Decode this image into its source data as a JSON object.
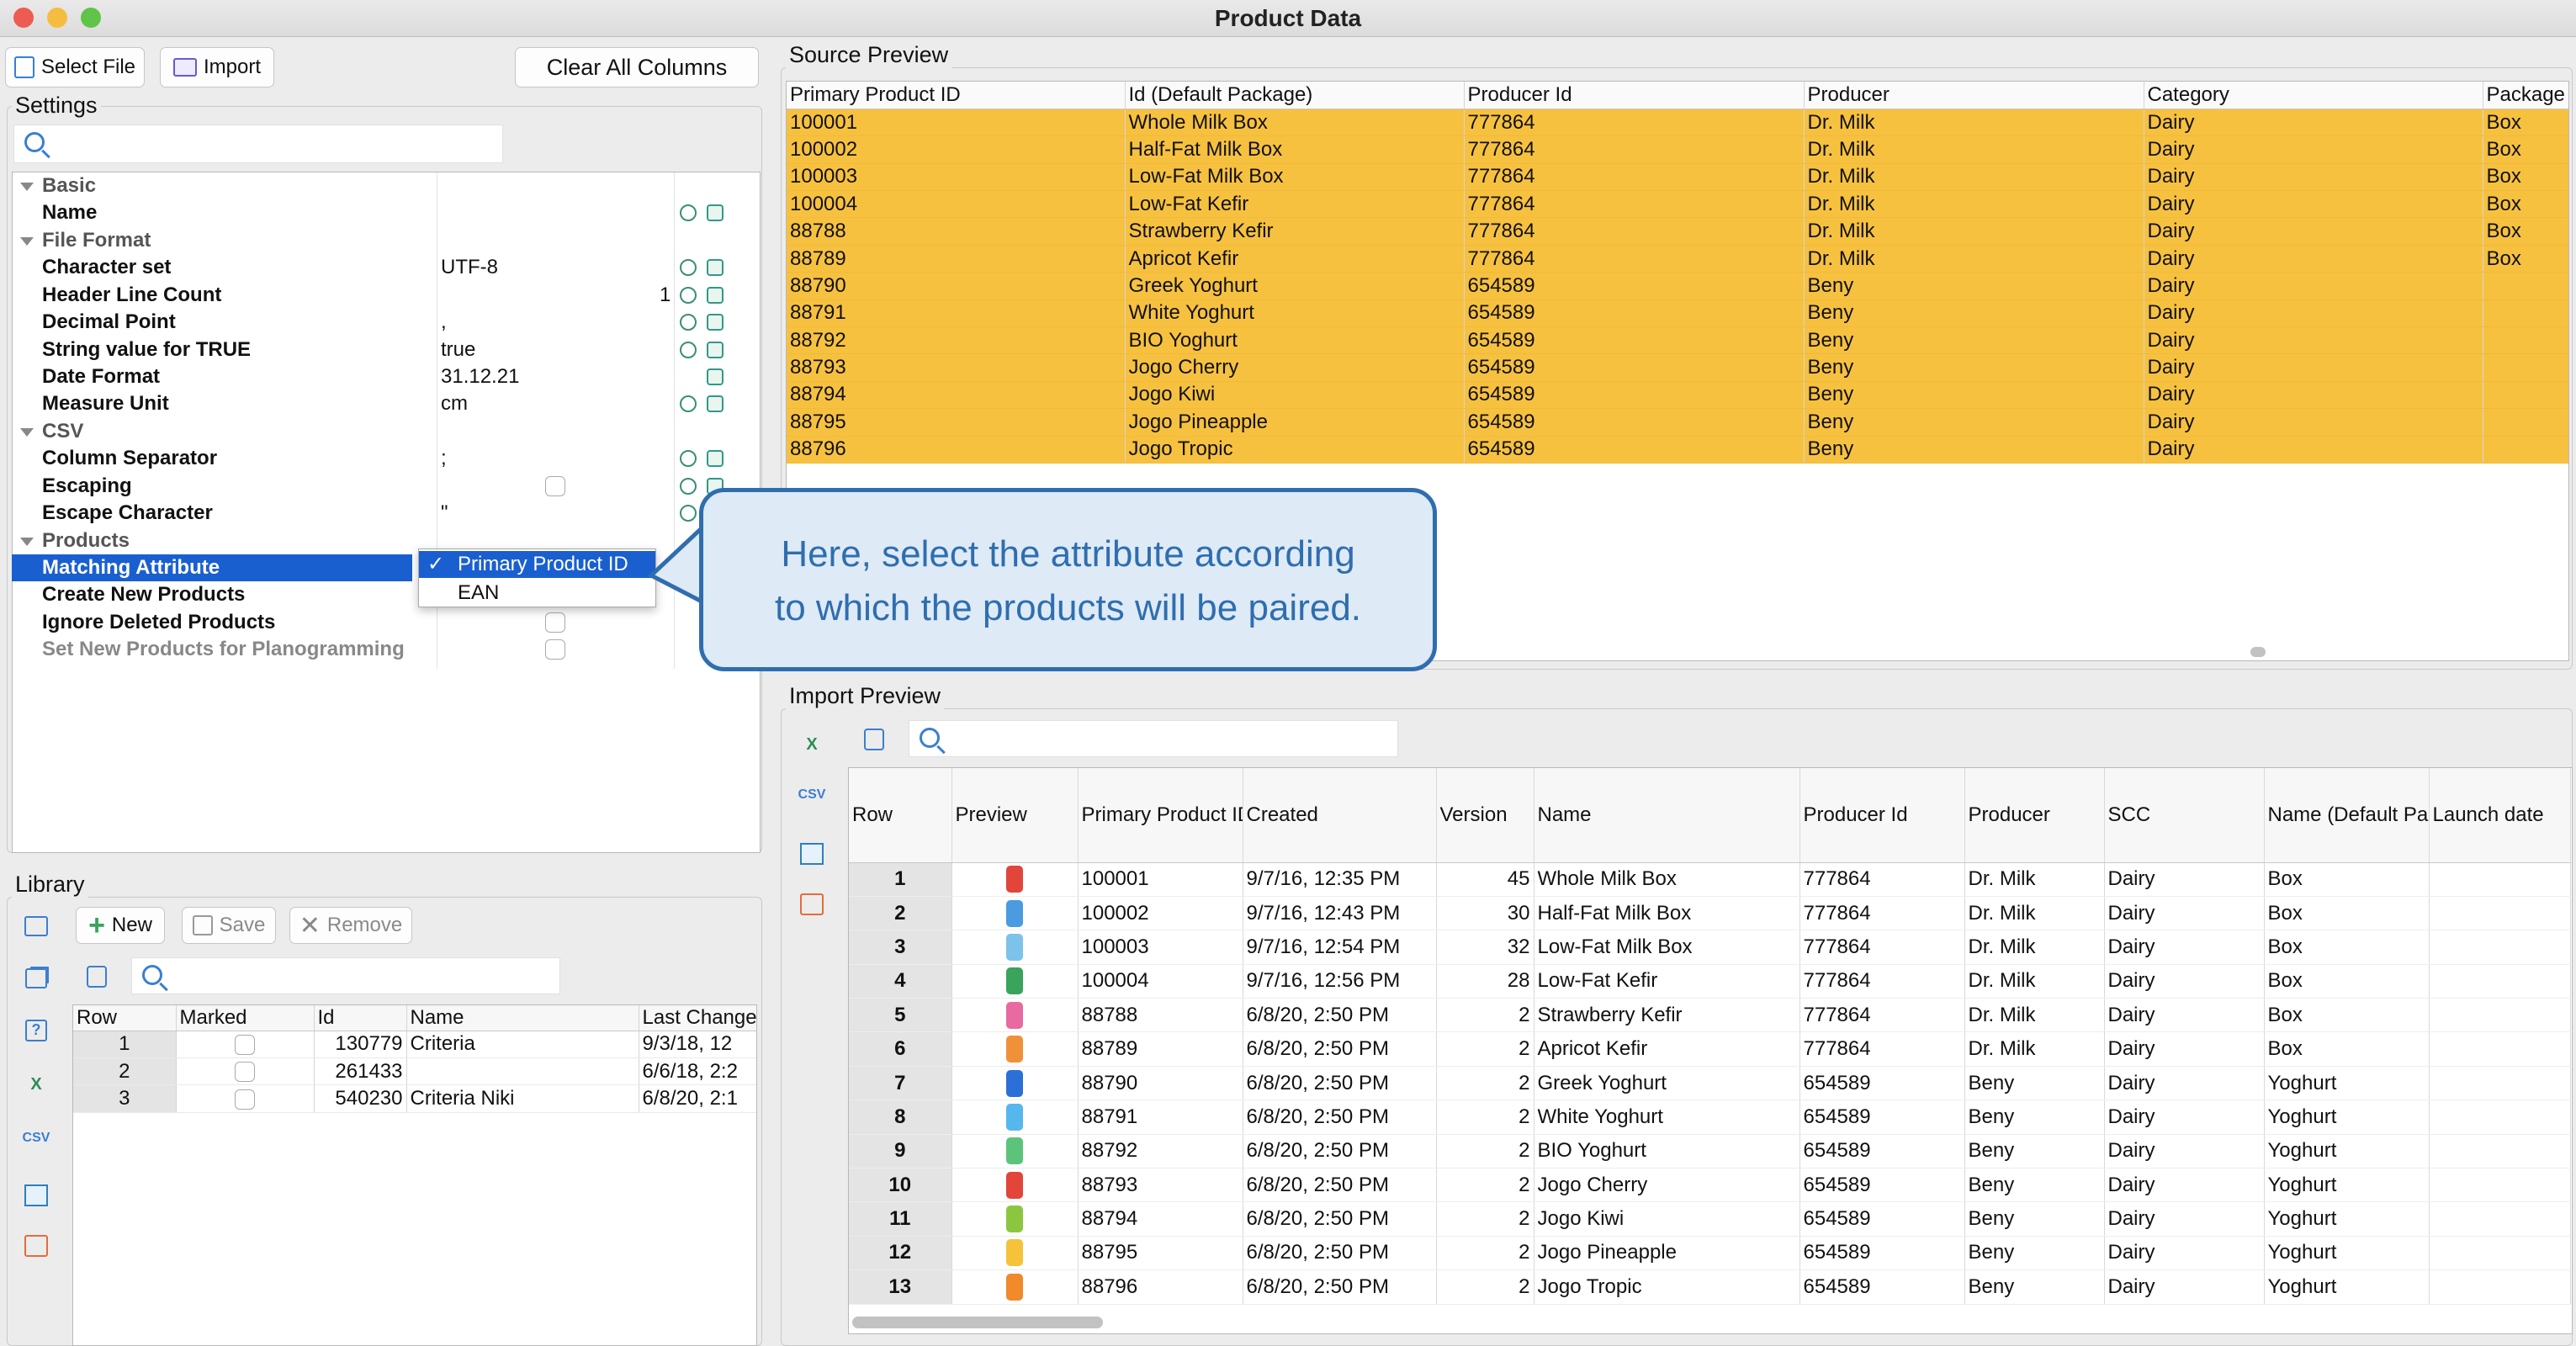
{
  "window": {
    "title": "Product Data"
  },
  "toolbar": {
    "select_file": "Select File",
    "import": "Import",
    "clear_all_columns": "Clear All Columns"
  },
  "settings": {
    "group_label": "Settings",
    "search_placeholder": "",
    "categories": {
      "basic": "Basic",
      "file_format": "File Format",
      "csv": "CSV",
      "products": "Products"
    },
    "rows": {
      "name": {
        "label": "Name",
        "value": ""
      },
      "charset": {
        "label": "Character set",
        "value": "UTF-8"
      },
      "header_lines": {
        "label": "Header Line Count",
        "value": "1"
      },
      "decimal_point": {
        "label": "Decimal Point",
        "value": ","
      },
      "true_string": {
        "label": "String value for TRUE",
        "value": "true"
      },
      "date_format": {
        "label": "Date Format",
        "value": "31.12.21"
      },
      "measure_unit": {
        "label": "Measure Unit",
        "value": "cm"
      },
      "column_separator": {
        "label": "Column Separator",
        "value": ";"
      },
      "escaping": {
        "label": "Escaping"
      },
      "escape_char": {
        "label": "Escape Character",
        "value": "\""
      },
      "matching_attribute": {
        "label": "Matching Attribute"
      },
      "create_new": {
        "label": "Create New Products"
      },
      "ignore_deleted": {
        "label": "Ignore Deleted Products"
      },
      "planogramming": {
        "label": "Set New Products for Planogramming"
      }
    }
  },
  "dropdown": {
    "options": [
      "Primary Product ID",
      "EAN"
    ],
    "selected": "Primary Product ID",
    "check": "✓"
  },
  "callout": {
    "line1": "Here, select the attribute according",
    "line2": "to which the products will be paired."
  },
  "source_preview": {
    "title": "Source Preview",
    "columns": [
      "Primary Product ID",
      "Id (Default Package)",
      "Producer Id",
      "Producer",
      "Category",
      "Package"
    ],
    "rows": [
      [
        "100001",
        "Whole Milk Box",
        "777864",
        "Dr. Milk",
        "Dairy",
        "Box"
      ],
      [
        "100002",
        "Half-Fat Milk Box",
        "777864",
        "Dr. Milk",
        "Dairy",
        "Box"
      ],
      [
        "100003",
        "Low-Fat Milk Box",
        "777864",
        "Dr. Milk",
        "Dairy",
        "Box"
      ],
      [
        "100004",
        "Low-Fat Kefir",
        "777864",
        "Dr. Milk",
        "Dairy",
        "Box"
      ],
      [
        "88788",
        "Strawberry Kefir",
        "777864",
        "Dr. Milk",
        "Dairy",
        "Box"
      ],
      [
        "88789",
        "Apricot Kefir",
        "777864",
        "Dr. Milk",
        "Dairy",
        "Box"
      ],
      [
        "88790",
        "Greek Yoghurt",
        "654589",
        "Beny",
        "Dairy",
        ""
      ],
      [
        "88791",
        "White Yoghurt",
        "654589",
        "Beny",
        "Dairy",
        ""
      ],
      [
        "88792",
        "BIO Yoghurt",
        "654589",
        "Beny",
        "Dairy",
        ""
      ],
      [
        "88793",
        "Jogo Cherry",
        "654589",
        "Beny",
        "Dairy",
        ""
      ],
      [
        "88794",
        "Jogo Kiwi",
        "654589",
        "Beny",
        "Dairy",
        ""
      ],
      [
        "88795",
        "Jogo Pineapple",
        "654589",
        "Beny",
        "Dairy",
        ""
      ],
      [
        "88796",
        "Jogo Tropic",
        "654589",
        "Beny",
        "Dairy",
        ""
      ]
    ]
  },
  "import_preview": {
    "title": "Import Preview",
    "search_placeholder": "",
    "columns": [
      "Row",
      "Preview",
      "Primary Product ID",
      "Created",
      "Version",
      "Name",
      "Producer Id",
      "Producer",
      "SCC",
      "Name (Default Package)",
      "Launch date"
    ],
    "rows": [
      [
        "1",
        "#e2453a",
        "100001",
        "9/7/16, 12:35 PM",
        "45",
        "Whole Milk Box",
        "777864",
        "Dr. Milk",
        "Dairy",
        "Box",
        ""
      ],
      [
        "2",
        "#4a9be0",
        "100002",
        "9/7/16, 12:43 PM",
        "30",
        "Half-Fat Milk Box",
        "777864",
        "Dr. Milk",
        "Dairy",
        "Box",
        ""
      ],
      [
        "3",
        "#7cc2ea",
        "100003",
        "9/7/16, 12:54 PM",
        "32",
        "Low-Fat Milk Box",
        "777864",
        "Dr. Milk",
        "Dairy",
        "Box",
        ""
      ],
      [
        "4",
        "#3aa35c",
        "100004",
        "9/7/16, 12:56 PM",
        "28",
        "Low-Fat Kefir",
        "777864",
        "Dr. Milk",
        "Dairy",
        "Box",
        ""
      ],
      [
        "5",
        "#e86aa0",
        "88788",
        "6/8/20, 2:50 PM",
        "2",
        "Strawberry Kefir",
        "777864",
        "Dr. Milk",
        "Dairy",
        "Box",
        ""
      ],
      [
        "6",
        "#f0913a",
        "88789",
        "6/8/20, 2:50 PM",
        "2",
        "Apricot Kefir",
        "777864",
        "Dr. Milk",
        "Dairy",
        "Box",
        ""
      ],
      [
        "7",
        "#2c6fd6",
        "88790",
        "6/8/20, 2:50 PM",
        "2",
        "Greek Yoghurt",
        "654589",
        "Beny",
        "Dairy",
        "Yoghurt",
        ""
      ],
      [
        "8",
        "#55b7ee",
        "88791",
        "6/8/20, 2:50 PM",
        "2",
        "White Yoghurt",
        "654589",
        "Beny",
        "Dairy",
        "Yoghurt",
        ""
      ],
      [
        "9",
        "#5cc47a",
        "88792",
        "6/8/20, 2:50 PM",
        "2",
        "BIO Yoghurt",
        "654589",
        "Beny",
        "Dairy",
        "Yoghurt",
        ""
      ],
      [
        "10",
        "#e2453a",
        "88793",
        "6/8/20, 2:50 PM",
        "2",
        "Jogo Cherry",
        "654589",
        "Beny",
        "Dairy",
        "Yoghurt",
        ""
      ],
      [
        "11",
        "#8cc63f",
        "88794",
        "6/8/20, 2:50 PM",
        "2",
        "Jogo Kiwi",
        "654589",
        "Beny",
        "Dairy",
        "Yoghurt",
        ""
      ],
      [
        "12",
        "#f5c23a",
        "88795",
        "6/8/20, 2:50 PM",
        "2",
        "Jogo Pineapple",
        "654589",
        "Beny",
        "Dairy",
        "Yoghurt",
        ""
      ],
      [
        "13",
        "#f08a2a",
        "88796",
        "6/8/20, 2:50 PM",
        "2",
        "Jogo Tropic",
        "654589",
        "Beny",
        "Dairy",
        "Yoghurt",
        ""
      ]
    ]
  },
  "library": {
    "title": "Library",
    "new": "New",
    "save": "Save",
    "remove": "Remove",
    "search_placeholder": "",
    "columns": [
      "Row",
      "Marked",
      "Id",
      "Name",
      "Last Change"
    ],
    "rows": [
      [
        "1",
        "",
        "130779",
        "Criteria",
        "9/3/18, 12"
      ],
      [
        "2",
        "",
        "261433",
        "",
        "6/6/18, 2:2"
      ],
      [
        "3",
        "",
        "540230",
        "Criteria Niki",
        "6/8/20, 2:1"
      ]
    ]
  },
  "icons": {
    "csv_label": "CSV",
    "excel_label": "X"
  },
  "colors": {
    "row_highlight": "#f7c140",
    "selection": "#1a5fd0",
    "accent": "#2f6eae"
  }
}
